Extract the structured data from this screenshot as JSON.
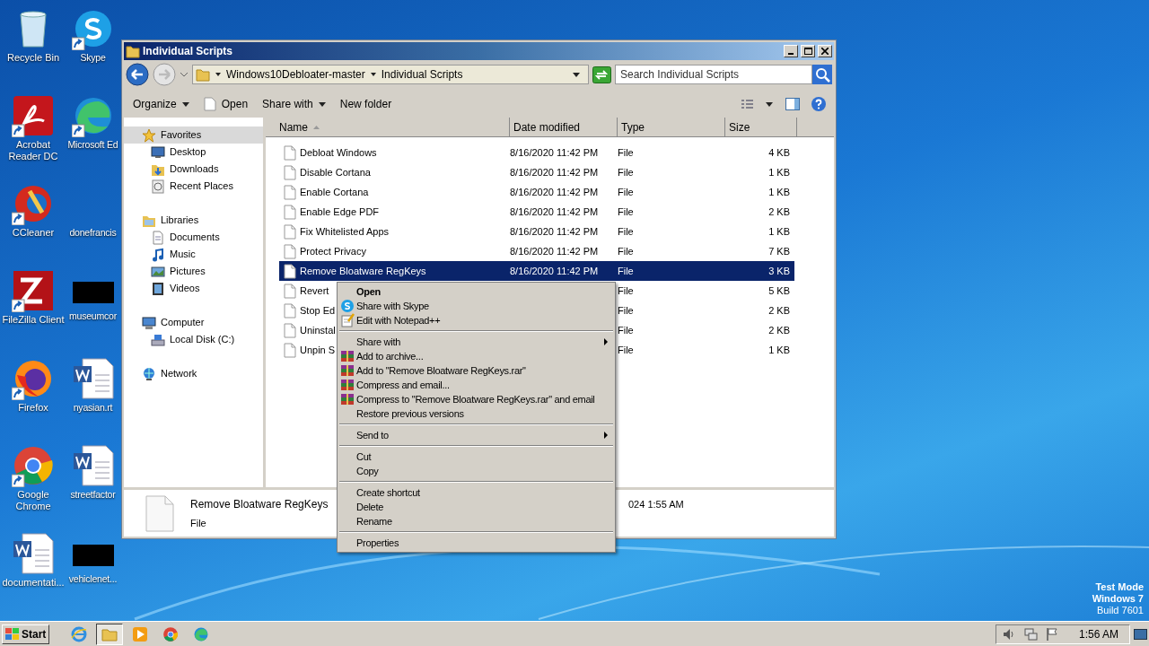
{
  "desktop": {
    "column_1": [
      {
        "label": "Recycle Bin",
        "kind": "recycle"
      },
      {
        "label": "Acrobat Reader DC",
        "kind": "acrobat"
      },
      {
        "label": "CCleaner",
        "kind": "ccleaner"
      },
      {
        "label": "FileZilla Client",
        "kind": "filezilla"
      },
      {
        "label": "Firefox",
        "kind": "firefox"
      },
      {
        "label": "Google Chrome",
        "kind": "chrome"
      },
      {
        "label": "documentati...",
        "kind": "word"
      }
    ],
    "column_2": [
      {
        "label": "Skype",
        "kind": "skype"
      },
      {
        "label": "Microsoft Ed",
        "kind": "edge"
      },
      {
        "label": "donefrancis",
        "kind": "none"
      },
      {
        "label": "museumcor",
        "kind": "redacted"
      },
      {
        "label": "nyasian.rt",
        "kind": "word"
      },
      {
        "label": "streetfactor",
        "kind": "word"
      },
      {
        "label": "vehiclenet...",
        "kind": "redacted"
      }
    ]
  },
  "window": {
    "title": "Individual Scripts",
    "address": [
      "Windows10Debloater-master",
      "Individual Scripts"
    ],
    "search": {
      "placeholder": "Search Individual Scripts"
    },
    "toolbar": [
      {
        "label": "Organize",
        "kind": "dropdown"
      },
      {
        "label": "Open",
        "kind": "open"
      },
      {
        "label": "Share with",
        "kind": "dropdown"
      },
      {
        "label": "New folder",
        "kind": "plain"
      }
    ],
    "nav": [
      {
        "label": "Favorites",
        "selected": true,
        "children": [
          {
            "label": "Desktop",
            "selected": false
          },
          {
            "label": "Downloads",
            "selected": false
          },
          {
            "label": "Recent Places",
            "selected": false
          }
        ]
      },
      {
        "label": "Libraries",
        "selected": false,
        "children": [
          {
            "label": "Documents",
            "selected": false
          },
          {
            "label": "Music",
            "selected": false
          },
          {
            "label": "Pictures",
            "selected": false
          },
          {
            "label": "Videos",
            "selected": false
          }
        ]
      },
      {
        "label": "Computer",
        "selected": false,
        "children": [
          {
            "label": "Local Disk (C:)",
            "selected": false
          }
        ]
      },
      {
        "label": "Network",
        "selected": false
      }
    ],
    "columns": [
      "Name",
      "Date modified",
      "Type",
      "Size"
    ],
    "rows": [
      {
        "name": "Debloat Windows",
        "date": "8/16/2020 11:42 PM",
        "type": "File",
        "size": "4 KB",
        "selected": false
      },
      {
        "name": "Disable Cortana",
        "date": "8/16/2020 11:42 PM",
        "type": "File",
        "size": "1 KB",
        "selected": false
      },
      {
        "name": "Enable Cortana",
        "date": "8/16/2020 11:42 PM",
        "type": "File",
        "size": "1 KB",
        "selected": false
      },
      {
        "name": "Enable Edge PDF",
        "date": "8/16/2020 11:42 PM",
        "type": "File",
        "size": "2 KB",
        "selected": false
      },
      {
        "name": "Fix Whitelisted Apps",
        "date": "8/16/2020 11:42 PM",
        "type": "File",
        "size": "1 KB",
        "selected": false
      },
      {
        "name": "Protect Privacy",
        "date": "8/16/2020 11:42 PM",
        "type": "File",
        "size": "7 KB",
        "selected": false
      },
      {
        "name": "Remove Bloatware RegKeys",
        "date": "8/16/2020 11:42 PM",
        "type": "File",
        "size": "3 KB",
        "selected": true
      },
      {
        "name": "Revert",
        "type": "File",
        "size": "5 KB",
        "selected": false
      },
      {
        "name": "Stop Ed",
        "type": "File",
        "size": "2 KB",
        "selected": false
      },
      {
        "name": "Uninstal",
        "type": "File",
        "size": "2 KB",
        "selected": false
      },
      {
        "name": "Unpin S",
        "type": "File",
        "size": "1 KB",
        "selected": false
      }
    ],
    "details": {
      "name": "Remove Bloatware RegKeys",
      "type": "File",
      "date": "024 1:55 AM"
    }
  },
  "context_menu": [
    {
      "kind": "item",
      "label": "Open",
      "default": true,
      "submenu": false
    },
    {
      "kind": "skype",
      "label": "Share with Skype",
      "default": false,
      "submenu": false
    },
    {
      "kind": "notepad",
      "label": "Edit with Notepad++",
      "default": false,
      "submenu": false
    },
    {
      "kind": "separator"
    },
    {
      "kind": "item",
      "label": "Share with",
      "default": false,
      "submenu": true
    },
    {
      "kind": "archive",
      "label": "Add to archive...",
      "default": false,
      "submenu": false
    },
    {
      "kind": "archive",
      "label": "Add to \"Remove Bloatware RegKeys.rar\"",
      "default": false,
      "submenu": false
    },
    {
      "kind": "archive",
      "label": "Compress and email...",
      "default": false,
      "submenu": false
    },
    {
      "kind": "archive",
      "label": "Compress to \"Remove Bloatware RegKeys.rar\" and email",
      "default": false,
      "submenu": false
    },
    {
      "kind": "item",
      "label": "Restore previous versions",
      "default": false,
      "submenu": false
    },
    {
      "kind": "separator"
    },
    {
      "kind": "item",
      "label": "Send to",
      "default": false,
      "submenu": true
    },
    {
      "kind": "separator"
    },
    {
      "kind": "item",
      "label": "Cut",
      "default": false,
      "submenu": false
    },
    {
      "kind": "item",
      "label": "Copy",
      "default": false,
      "submenu": false
    },
    {
      "kind": "separator"
    },
    {
      "kind": "item",
      "label": "Create shortcut",
      "default": false,
      "submenu": false
    },
    {
      "kind": "item",
      "label": "Delete",
      "default": false,
      "submenu": false
    },
    {
      "kind": "item",
      "label": "Rename",
      "default": false,
      "submenu": false
    },
    {
      "kind": "separator"
    },
    {
      "kind": "item",
      "label": "Properties",
      "default": false,
      "submenu": false
    }
  ],
  "os_notice": [
    "Test Mode",
    "Windows 7",
    "Build 7601"
  ],
  "taskbar": {
    "start": "Start",
    "apps": [
      {
        "kind": "ie",
        "active": false
      },
      {
        "kind": "explorer",
        "active": true
      },
      {
        "kind": "media",
        "active": false
      },
      {
        "kind": "chrome",
        "active": false
      },
      {
        "kind": "edge",
        "active": false
      }
    ],
    "time": "1:56 AM"
  }
}
